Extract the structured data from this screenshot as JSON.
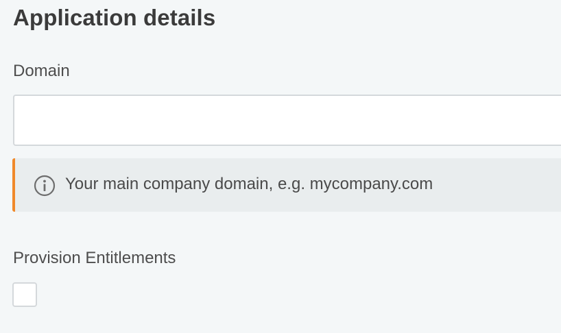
{
  "section": {
    "title": "Application details"
  },
  "domain_field": {
    "label": "Domain",
    "value": "",
    "placeholder": "",
    "help_text": "Your main company domain, e.g. mycompany.com",
    "help_icon": "info-icon",
    "help_accent_color": "#f0892a"
  },
  "provision_entitlements": {
    "label": "Provision Entitlements",
    "checked": false
  }
}
